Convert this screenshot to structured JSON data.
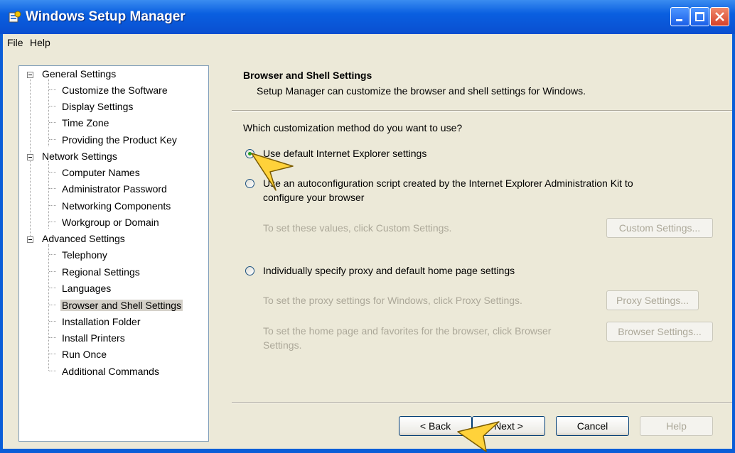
{
  "window": {
    "title": "Windows Setup Manager"
  },
  "menu": [
    "File",
    "Help"
  ],
  "tree": {
    "general": "General Settings",
    "general_items": [
      "Customize the Software",
      "Display Settings",
      "Time Zone",
      "Providing the Product Key"
    ],
    "network": "Network Settings",
    "network_items": [
      "Computer Names",
      "Administrator Password",
      "Networking Components",
      "Workgroup or Domain"
    ],
    "advanced": "Advanced Settings",
    "advanced_items": [
      "Telephony",
      "Regional Settings",
      "Languages",
      "Browser and Shell Settings",
      "Installation Folder",
      "Install Printers",
      "Run Once",
      "Additional Commands"
    ],
    "selected": "Browser and Shell Settings"
  },
  "page": {
    "title": "Browser and Shell Settings",
    "description": "Setup Manager can customize the browser and shell settings for Windows.",
    "question": "Which customization method do you want to use?",
    "option1": "Use default Internet Explorer settings",
    "option2_line1": "Use an autoconfiguration script created by the Internet Explorer Administration Kit to",
    "option2_line2": "configure your browser",
    "custom_hint": "To set these values, click Custom Settings.",
    "custom_button": "Custom Settings...",
    "option3": "Individually specify proxy and default home page settings",
    "proxy_hint": "To set the proxy settings for Windows, click Proxy Settings.",
    "proxy_button": "Proxy Settings...",
    "browser_hint_line1": "To set the home page and favorites for the browser, click Browser",
    "browser_hint_line2": "Settings.",
    "browser_button": "Browser Settings...",
    "selected_option": 1
  },
  "footer": {
    "back": "< Back",
    "next": "Next >",
    "cancel": "Cancel",
    "help": "Help"
  },
  "colors": {
    "titlebar": "#0a5fe0",
    "face": "#ece9d8",
    "disabled_text": "#aca899",
    "pointer": "#ffd23a"
  }
}
